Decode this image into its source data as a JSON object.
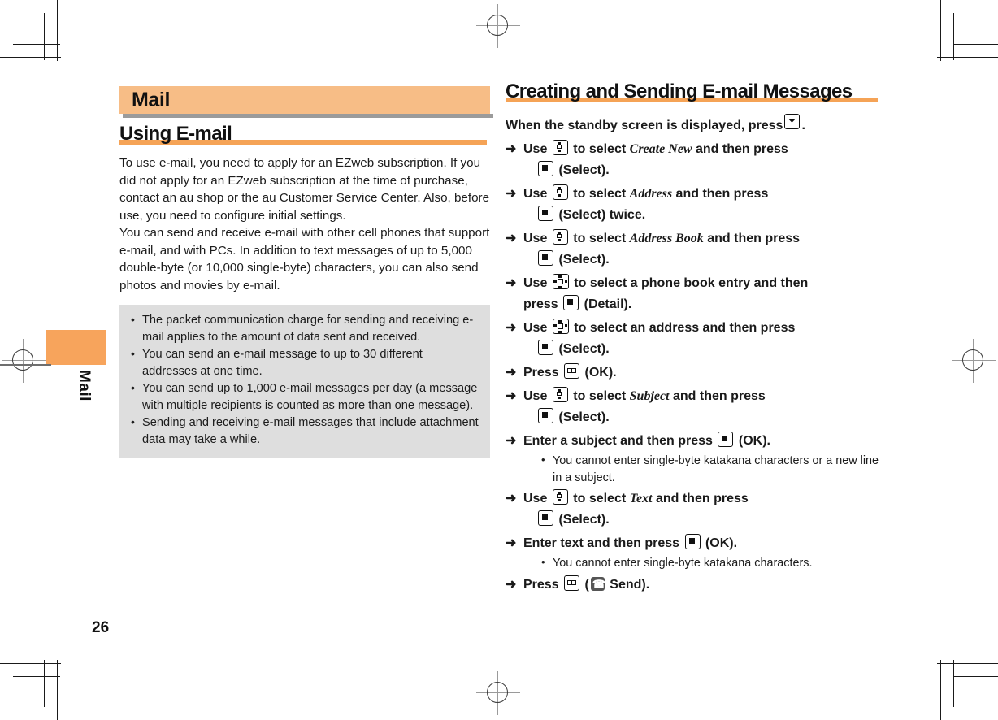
{
  "page": {
    "number": "26",
    "side_tab_label": "Mail",
    "chapter_title": "Mail"
  },
  "left_column": {
    "heading": "Using E-mail",
    "paragraphs": [
      "To use e-mail, you need to apply for an EZweb subscription. If you did not apply for an EZweb subscription at the time of purchase, contact an au shop or the au Customer Service Center. Also, before use, you need to configure initial settings.",
      "You can send and receive e-mail with other cell phones that support e-mail, and with PCs. In addition to text messages of up to 5,000 double-byte (or 10,000 single-byte) characters, you can also send photos and movies by e-mail."
    ],
    "notes": [
      "The packet communication charge for sending and receiving e-mail applies to the amount of data sent and received.",
      "You can send an e-mail message to up to 30 different addresses at one time.",
      "You can send up to 1,000 e-mail messages per day (a message with multiple recipients is counted as more than one message).",
      "Sending and receiving e-mail messages that include attachment data may take a while."
    ]
  },
  "right_column": {
    "heading": "Creating and Sending E-mail Messages",
    "lead": {
      "before": "When the standby screen is displayed, press",
      "icon": "envelope-key-icon",
      "after": "."
    },
    "steps": [
      {
        "arrow": "➜",
        "line1_pre": "Use",
        "key1": "updown-key-icon",
        "line1_mid": "to select",
        "emphasis": "Create New",
        "line1_post": "and then press",
        "key2": "select-key-icon",
        "line2_post": "(Select)."
      },
      {
        "arrow": "➜",
        "line1_pre": "Use",
        "key1": "updown-key-icon",
        "line1_mid": "to select",
        "emphasis": "Address",
        "line1_post": "and then press",
        "key2": "select-key-icon",
        "line2_post": "(Select) twice."
      },
      {
        "arrow": "➜",
        "line1_pre": "Use",
        "key1": "updown-key-icon",
        "line1_mid": "to select",
        "emphasis": "Address Book",
        "line1_post": "and then press",
        "key2": "select-key-icon",
        "line2_post": "(Select)."
      },
      {
        "arrow": "➜",
        "line1_pre": "Use",
        "key1": "fourway-key-icon",
        "line1_mid": "to select a phone book entry and then",
        "line2_pre": "press",
        "key2": "select-key-icon",
        "line2_post": "(Detail)."
      },
      {
        "arrow": "➜",
        "line1_pre": "Use",
        "key1": "fourway-key-icon",
        "line1_mid": "to select an address and then press",
        "key2": "select-key-icon",
        "line2_post": "(Select)."
      },
      {
        "arrow": "➜",
        "line1_pre": "Press",
        "key1": "book-key-icon",
        "line1_post": "(OK)."
      },
      {
        "arrow": "➜",
        "line1_pre": "Use",
        "key1": "updown-key-icon",
        "line1_mid": "to select",
        "emphasis": "Subject",
        "line1_post": "and then press",
        "key2": "select-key-icon",
        "line2_post": "(Select)."
      },
      {
        "arrow": "➜",
        "line1_pre": "Enter a subject and then press",
        "key1": "select-key-icon",
        "line1_post": "(OK).",
        "substeps": [
          "You cannot enter single-byte katakana characters or a new line in a subject."
        ]
      },
      {
        "arrow": "➜",
        "line1_pre": "Use",
        "key1": "updown-key-icon",
        "line1_mid": "to select",
        "emphasis": "Text",
        "line1_post": "and then press",
        "key2": "select-key-icon",
        "line2_post": "(Select)."
      },
      {
        "arrow": "➜",
        "line1_pre": "Enter text and then press",
        "key1": "select-key-icon",
        "line1_post": "(OK).",
        "substeps": [
          "You cannot enter single-byte katakana characters."
        ]
      },
      {
        "arrow": "➜",
        "line1_pre": "Press",
        "key1": "book-key-icon",
        "line1_paren_open": "(",
        "key2": "send-icon",
        "line1_post": "Send)."
      }
    ]
  },
  "colors": {
    "banner_orange": "#F7BD86",
    "tab_orange": "#F7A45C",
    "rule_orange": "#F5A356",
    "notes_gray": "#DEDEDE",
    "shadow_gray": "#9B9B9B",
    "text_black": "#1A1A1A"
  }
}
